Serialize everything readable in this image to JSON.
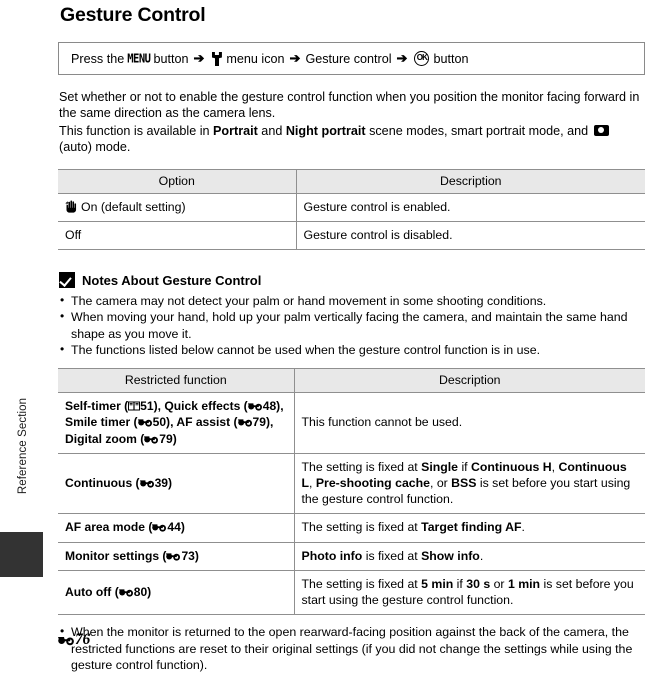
{
  "side": {
    "section_label": "Reference Section"
  },
  "page_title": "Gesture Control",
  "nav_path": {
    "press_the": "Press the",
    "menu_glyph": "MENU",
    "button_1": "button",
    "arrow": "➔",
    "setup_menu_icon": "wrench-icon",
    "menu_icon_label": "menu icon",
    "item": "Gesture control",
    "ok_glyph": "OK",
    "button_2": "button"
  },
  "intro": {
    "p1": "Set whether or not to enable the gesture control function when you position the monitor facing forward in the same direction as the camera lens.",
    "p2_a": "This function is available in ",
    "p2_b": "Portrait",
    "p2_c": " and ",
    "p2_d": "Night portrait",
    "p2_e": " scene modes, smart portrait mode, and ",
    "p2_f": " (auto) mode."
  },
  "option_table": {
    "headers": [
      "Option",
      "Description"
    ],
    "rows": [
      {
        "option_icon": "hand-icon",
        "option": "On (default setting)",
        "description": "Gesture control is enabled."
      },
      {
        "option_icon": "",
        "option": "Off",
        "description": "Gesture control is disabled."
      }
    ]
  },
  "notes": {
    "title": "Notes About Gesture Control",
    "icon": "warning-checkmark-icon",
    "bullets": [
      "The camera may not detect your palm or hand movement in some shooting conditions.",
      "When moving your hand, hold up your palm vertically facing the camera, and maintain the same hand shape as you move it.",
      "The functions listed below cannot be used when the gesture control function is in use."
    ]
  },
  "restricted_table": {
    "headers": [
      "Restricted function",
      "Description"
    ],
    "rows": [
      {
        "function_parts": [
          {
            "t": "Self-timer (",
            "k": "text"
          },
          {
            "t": "book-icon",
            "k": "icon"
          },
          {
            "t": "51), Quick effects (",
            "k": "text"
          },
          {
            "t": "e-glyph",
            "k": "icon"
          },
          {
            "t": "48), Smile timer (",
            "k": "text"
          },
          {
            "t": "e-glyph",
            "k": "icon"
          },
          {
            "t": "50), AF assist (",
            "k": "text"
          },
          {
            "t": "e-glyph",
            "k": "icon"
          },
          {
            "t": "79), Digital zoom (",
            "k": "text"
          },
          {
            "t": "e-glyph",
            "k": "icon"
          },
          {
            "t": "79)",
            "k": "text"
          }
        ],
        "function_plain": "Self-timer (A51), Quick effects (E48), Smile timer (E50), AF assist (E79), Digital zoom (E79)",
        "description_plain": "This function cannot be used."
      },
      {
        "function_plain": "Continuous (E39)",
        "description_plain": "The setting is fixed at Single if Continuous H, Continuous L, Pre-shooting cache, or BSS is set before you start using the gesture control function."
      },
      {
        "function_plain": "AF area mode (E44)",
        "description_plain": "The setting is fixed at Target finding AF."
      },
      {
        "function_plain": "Monitor settings (E73)",
        "description_plain": "Photo info is fixed at Show info."
      },
      {
        "function_plain": "Auto off (E80)",
        "description_plain": "The setting is fixed at 5 min if 30 s or 1 min is set before you start using the gesture control function."
      }
    ],
    "labels": {
      "r1_pre": "Self-timer (",
      "r1_a": "51), Quick effects (",
      "r1_b": "48), Smile timer (",
      "r1_c": "50), AF assist (",
      "r1_d": "79), Digital zoom (",
      "r1_e": "79)",
      "r1_desc": "This function cannot be used.",
      "r2_name": "Continuous (",
      "r2_num": "39)",
      "r2_d1": "The setting is fixed at ",
      "r2_d2": "Single",
      "r2_d3": " if ",
      "r2_d4": "Continuous H",
      "r2_d5": ", ",
      "r2_d6": "Continuous L",
      "r2_d7": ", ",
      "r2_d8": "Pre-shooting cache",
      "r2_d9": ", or ",
      "r2_d10": "BSS",
      "r2_d11": " is set before you start using the gesture control function.",
      "r3_name": "AF area mode (",
      "r3_num": "44)",
      "r3_d1": "The setting is fixed at ",
      "r3_d2": "Target finding AF",
      "r3_d3": ".",
      "r4_name": "Monitor settings (",
      "r4_num": "73)",
      "r4_d1": "Photo info",
      "r4_d2": " is fixed at ",
      "r4_d3": "Show info",
      "r4_d4": ".",
      "r5_name": "Auto off (",
      "r5_num": "80)",
      "r5_d1": "The setting is fixed at ",
      "r5_d2": "5 min",
      "r5_d3": " if ",
      "r5_d4": "30 s",
      "r5_d5": " or ",
      "r5_d6": "1 min",
      "r5_d7": " is set before you start using the gesture control function."
    }
  },
  "closing_bullet": "When the monitor is returned to the open rearward-facing position against the back of the camera, the restricted functions are reset to their original settings (if you did not change the settings while using the gesture control function).",
  "footer": {
    "marker": "e-glyph",
    "page": "76"
  },
  "colors": {
    "table_header_bg": "#e8e8e8",
    "rule": "#8f8f8f",
    "tab": "#333333",
    "text": "#000000"
  }
}
